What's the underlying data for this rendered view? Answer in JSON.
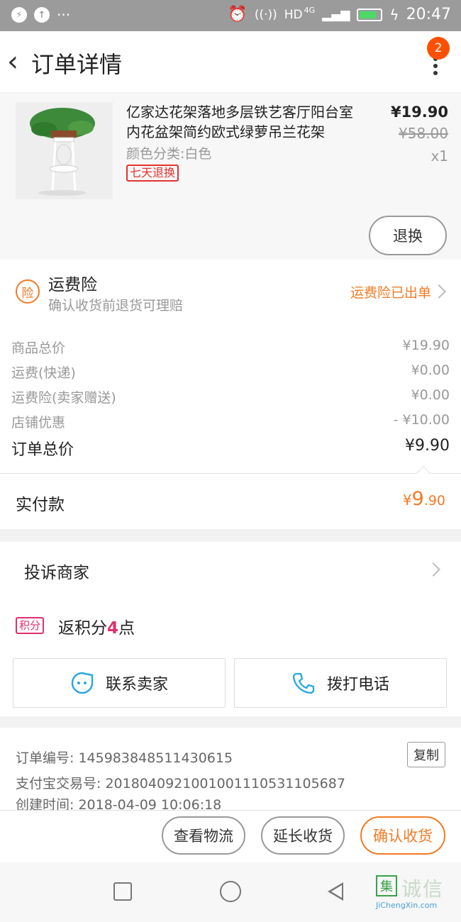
{
  "status_bar": {
    "network": "HD",
    "network_gen": "4G",
    "time": "20:47"
  },
  "header": {
    "title": "订单详情",
    "badge_count": "2"
  },
  "product": {
    "title": "亿家达花架落地多层铁艺客厅阳台室内花盆架简约欧式绿萝吊兰花架",
    "spec": "颜色分类:白色",
    "tag": "七天退换",
    "price": "¥19.90",
    "original_price": "¥58.00",
    "quantity": "x1",
    "return_button": "退换"
  },
  "insurance": {
    "icon_char": "险",
    "title": "运费险",
    "subtitle": "确认收货前退货可理赔",
    "status": "运费险已出单"
  },
  "costs": {
    "rows": [
      {
        "label": "商品总价",
        "value": "¥19.90"
      },
      {
        "label": "运费(快递)",
        "value": "¥0.00"
      },
      {
        "label": "运费险(卖家赠送)",
        "value": "¥0.00"
      },
      {
        "label": "店铺优惠",
        "value": "- ¥10.00"
      }
    ],
    "total_label": "订单总价",
    "total_value": "¥9.90"
  },
  "paid": {
    "label": "实付款",
    "currency": "¥",
    "integer": "9",
    "decimal": ".90"
  },
  "complaint": {
    "label": "投诉商家"
  },
  "points": {
    "tag": "积分",
    "prefix": "返积分",
    "number": "4",
    "suffix": "点"
  },
  "actions": {
    "contact_seller": "联系卖家",
    "call_phone": "拨打电话"
  },
  "order_info": {
    "order_no_label": "订单编号:",
    "order_no": "145983848511430615",
    "copy_button": "复制",
    "alipay_label": "支付宝交易号:",
    "alipay_no": "2018040921001001110531105687",
    "created_label": "创建时间:",
    "created_time": "2018-04-09 10:06:18"
  },
  "bottom_bar": {
    "logistics": "查看物流",
    "extend": "延长收货",
    "confirm": "确认收货"
  },
  "watermark": {
    "logo_char": "集",
    "text": "诚信",
    "url": "JiChengXin.com"
  },
  "colors": {
    "accent": "#f27a24",
    "badge": "#ff5000",
    "points": "#e0306b",
    "tag_red": "#e5322d"
  }
}
